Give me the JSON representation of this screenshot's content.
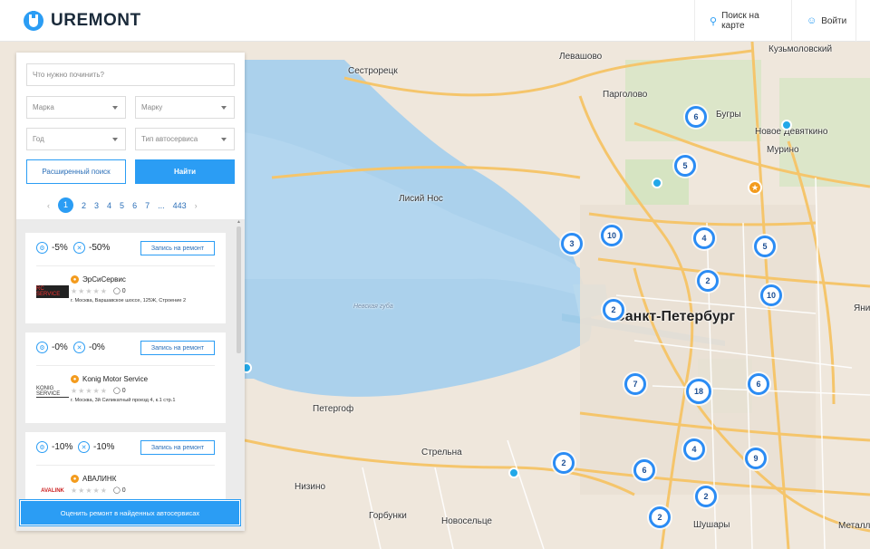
{
  "header": {
    "logo_text": "UREMONT",
    "map_search_label": "Поиск на карте",
    "login_label": "Войти"
  },
  "search": {
    "query_placeholder": "Что нужно починить?",
    "brand_placeholder": "Марка",
    "model_placeholder": "Марку",
    "year_placeholder": "Год",
    "service_type_placeholder": "Тип автосервиса",
    "advanced_label": "Расширенный поиск",
    "find_label": "Найти"
  },
  "pagination": {
    "pages": [
      "1",
      "2",
      "3",
      "4",
      "5",
      "6",
      "7"
    ],
    "ellipsis": "...",
    "last": "443",
    "current": "1"
  },
  "results": [
    {
      "discount_parts": "-5%",
      "discount_work": "-50%",
      "book_label": "Запись на ремонт",
      "name": "ЭрСиСервис",
      "reviews": "0",
      "address": "г. Москва, Варшавское шоссе, 125Ж, Строение 2",
      "logo_text": "RC SERVICE"
    },
    {
      "discount_parts": "-0%",
      "discount_work": "-0%",
      "book_label": "Запись на ремонт",
      "name": "Konig Motor Service",
      "reviews": "0",
      "address": "г. Москва, 3й Силикатный проезд 4, к.1 стр.1",
      "logo_text": "KONIG SERVICE"
    },
    {
      "discount_parts": "-10%",
      "discount_work": "-10%",
      "book_label": "Запись на ремонт",
      "name": "АВАЛИНК",
      "reviews": "0",
      "address": "",
      "logo_text": "AVALINK"
    }
  ],
  "evaluate_label": "Оценить ремонт в найденных автосервисах",
  "map": {
    "places": [
      "Сестрорецк",
      "Левашово",
      "Парголово",
      "Бугры",
      "Кузьмоловский",
      "Новое Девяткино",
      "Мурино",
      "Лисий Нос",
      "Санкт-Петербург",
      "Петергоф",
      "Стрельна",
      "Низино",
      "Горбунки",
      "Новосельце",
      "Шушары",
      "Металло",
      "Яни",
      "Невская губа"
    ],
    "clusters": [
      "6",
      "5",
      "10",
      "3",
      "4",
      "5",
      "2",
      "10",
      "2",
      "7",
      "18",
      "6",
      "4",
      "9",
      "2",
      "6",
      "2",
      "2"
    ],
    "accent_color": "#2b9df4"
  }
}
